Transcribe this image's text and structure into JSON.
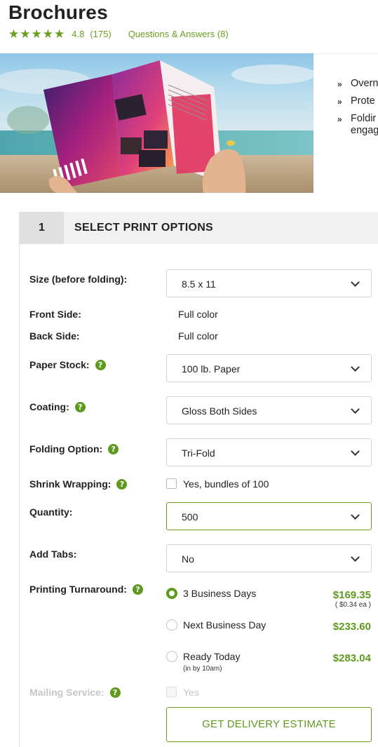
{
  "product": {
    "title": "Brochures",
    "rating": 4.8,
    "rating_label": "4.8",
    "review_count": "(175)",
    "qa_link": "Questions & Answers (8)",
    "stars": 5
  },
  "features": [
    {
      "text": "Overn"
    },
    {
      "text": "Prote"
    },
    {
      "text": "Foldir\nengag"
    }
  ],
  "section": {
    "step": "1",
    "title": "SELECT PRINT OPTIONS"
  },
  "options": {
    "size": {
      "label": "Size (before folding):",
      "value": "8.5 x 11"
    },
    "front_side": {
      "label": "Front Side:",
      "value": "Full color"
    },
    "back_side": {
      "label": "Back Side:",
      "value": "Full color"
    },
    "paper_stock": {
      "label": "Paper Stock:",
      "value": "100 lb. Paper"
    },
    "coating": {
      "label": "Coating:",
      "value": "Gloss Both Sides"
    },
    "folding": {
      "label": "Folding Option:",
      "value": "Tri-Fold"
    },
    "shrink": {
      "label": "Shrink Wrapping:",
      "option": "Yes, bundles of 100",
      "checked": false
    },
    "quantity": {
      "label": "Quantity:",
      "value": "500"
    },
    "tabs": {
      "label": "Add Tabs:",
      "value": "No"
    },
    "turnaround": {
      "label": "Printing Turnaround:",
      "choices": [
        {
          "label": "3 Business Days",
          "price": "$169.35",
          "each": "( $0.34 ea )",
          "selected": true
        },
        {
          "label": "Next Business Day",
          "price": "$233.60",
          "selected": false
        },
        {
          "label": "Ready Today",
          "sub": "(in by 10am)",
          "price": "$283.04",
          "selected": false
        }
      ]
    },
    "mailing": {
      "label": "Mailing Service:",
      "option": "Yes",
      "disabled": true
    }
  },
  "cta": {
    "label": "GET DELIVERY ESTIMATE"
  },
  "colors": {
    "accent": "#5f9a1f",
    "border": "#d3d3d3",
    "header_bg": "#f1f1f1"
  },
  "icons": {
    "help": "help-circle-icon",
    "caret": "chevron-down-icon",
    "star": "star-icon",
    "bullet": "double-chevron-right-icon"
  }
}
